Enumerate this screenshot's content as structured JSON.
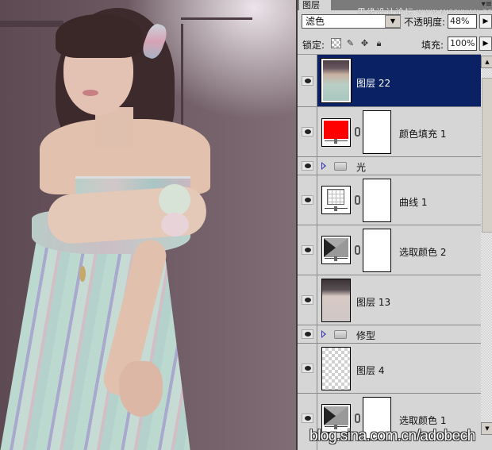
{
  "canvas": {
    "description": "Photo of a woman in a pastel dress against dark mauve wall",
    "colors": {
      "background": "#6a5760",
      "dress": "#bcd9d0",
      "skin": "#e2c2ae",
      "hair": "#3c2a2c"
    }
  },
  "panel": {
    "tab_label": "图层",
    "menu_icon": "panel-menu-icon",
    "watermark_cn": "思缘设计论坛",
    "watermark_url": "WWW.MISSYUAN.COM",
    "blend_mode": "滤色",
    "opacity_label": "不透明度:",
    "opacity_value": "48%",
    "lock_label": "锁定:",
    "lock_icons": [
      "lock-transparent-icon",
      "lock-paint-icon",
      "lock-move-icon",
      "lock-all-icon"
    ],
    "fill_label": "填充:",
    "fill_value": "100%",
    "selected_color": "#0a2164"
  },
  "layers": [
    {
      "name": "图层 22",
      "type": "pixel",
      "visible": true,
      "selected": true
    },
    {
      "name": "颜色填充 1",
      "type": "color-fill",
      "visible": true,
      "fill_color": "#ff0000",
      "has_mask": true
    },
    {
      "name": "光",
      "type": "group",
      "visible": true,
      "collapsed": true
    },
    {
      "name": "曲线 1",
      "type": "curves",
      "visible": true,
      "has_mask": true
    },
    {
      "name": "选取颜色 2",
      "type": "selective-color",
      "visible": true,
      "has_mask": true
    },
    {
      "name": "图层 13",
      "type": "pixel",
      "visible": true
    },
    {
      "name": "修型",
      "type": "group",
      "visible": true,
      "collapsed": true
    },
    {
      "name": "图层 4",
      "type": "pixel-transparent",
      "visible": true
    },
    {
      "name": "选取颜色 1",
      "type": "selective-color",
      "visible": true,
      "has_mask": true
    }
  ],
  "footer_watermark": "blog.sina.com.cn/adobech"
}
